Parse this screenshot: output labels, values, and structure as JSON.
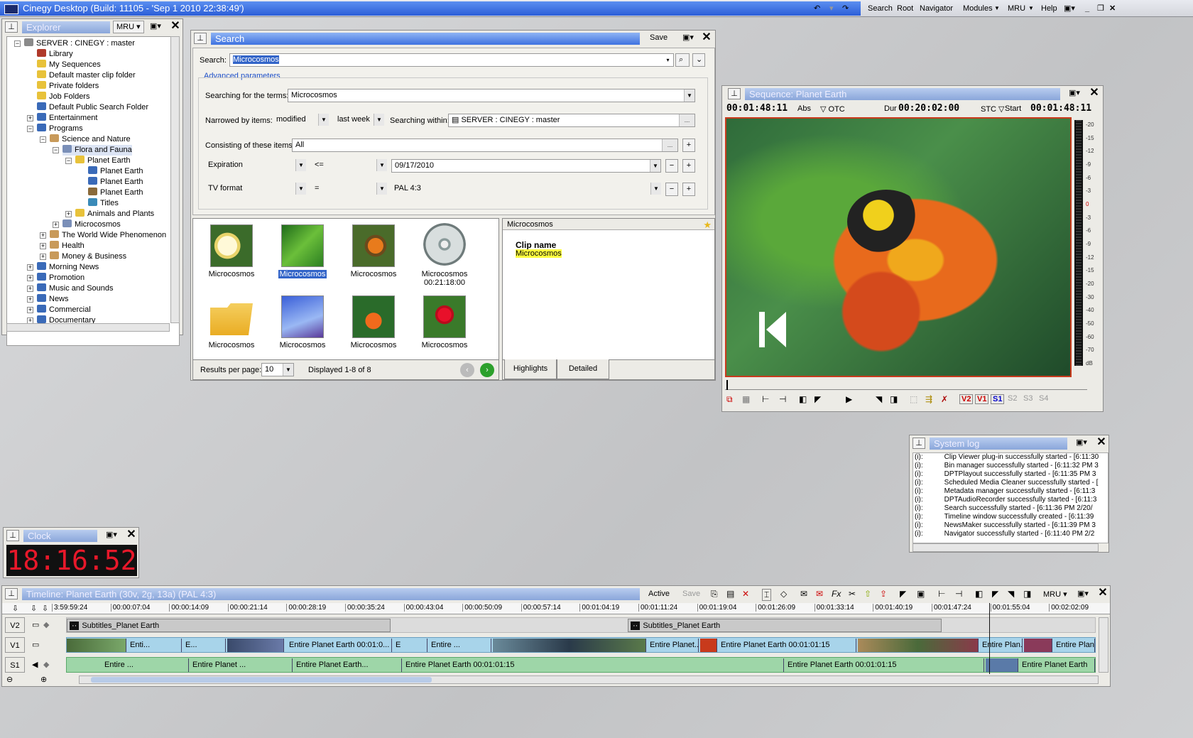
{
  "app": {
    "title": "Cinegy Desktop (Build: 11105 - 'Sep  1 2010 22:38:49')",
    "menu": [
      "Search",
      "Root",
      "Navigator",
      "Modules",
      "MRU",
      "Help"
    ]
  },
  "explorer": {
    "title": "Explorer",
    "mru": "MRU",
    "items": [
      {
        "label": "SERVER : CINEGY : master",
        "level": 0
      },
      {
        "label": "Library",
        "level": 1
      },
      {
        "label": "My Sequences",
        "level": 1
      },
      {
        "label": "Default master clip folder",
        "level": 1
      },
      {
        "label": "Private folders",
        "level": 1
      },
      {
        "label": "Job Folders",
        "level": 1
      },
      {
        "label": "Default Public Search Folder",
        "level": 1
      },
      {
        "label": "Entertainment",
        "level": 1
      },
      {
        "label": "Programs",
        "level": 1
      },
      {
        "label": "Science and Nature",
        "level": 2
      },
      {
        "label": "Flora and Fauna",
        "level": 3
      },
      {
        "label": "Planet Earth",
        "level": 4
      },
      {
        "label": "Planet Earth",
        "level": 5
      },
      {
        "label": "Planet Earth",
        "level": 5
      },
      {
        "label": "Planet Earth",
        "level": 5
      },
      {
        "label": "Titles",
        "level": 5
      },
      {
        "label": "Animals and Plants",
        "level": 4
      },
      {
        "label": "Microcosmos",
        "level": 3
      },
      {
        "label": "The World Wide Phenomenon",
        "level": 2
      },
      {
        "label": "Health",
        "level": 2
      },
      {
        "label": "Money & Business",
        "level": 2
      },
      {
        "label": "Morning News",
        "level": 1
      },
      {
        "label": "Promotion",
        "level": 1
      },
      {
        "label": "Music and Sounds",
        "level": 1
      },
      {
        "label": "News",
        "level": 1
      },
      {
        "label": "Commercial",
        "level": 1
      },
      {
        "label": "Documentary",
        "level": 1
      }
    ]
  },
  "search": {
    "title": "Search",
    "save": "Save",
    "search_label": "Search:",
    "search_value": "Microcosmos",
    "advanced": "Advanced parameters",
    "terms_label": "Searching for the terms:",
    "terms_value": "Microcosmos",
    "narrowed_label": "Narrowed by items:",
    "narrowed_value": "modified",
    "period_value": "last week",
    "within_label": "Searching within:",
    "within_value": "SERVER : CINEGY : master",
    "consisting_label": "Consisting of these items:",
    "consisting_value": "All",
    "cond1": {
      "field": "Expiration",
      "op": "<=",
      "value": "09/17/2010"
    },
    "cond2": {
      "field": "TV format",
      "op": "=",
      "value": "PAL 4:3"
    },
    "results": [
      {
        "label": "Microcosmos",
        "sub": ""
      },
      {
        "label": "Microcosmos",
        "sub": ""
      },
      {
        "label": "Microcosmos",
        "sub": ""
      },
      {
        "label": "Microcosmos",
        "sub": "00:21:18:00"
      },
      {
        "label": "Microcosmos",
        "sub": ""
      },
      {
        "label": "Microcosmos",
        "sub": ""
      },
      {
        "label": "Microcosmos",
        "sub": ""
      },
      {
        "label": "Microcosmos",
        "sub": ""
      }
    ],
    "per_page_label": "Results per page:",
    "per_page_value": "10",
    "displayed": "Displayed 1-8 of 8",
    "detail_title": "Microcosmos",
    "clip_name_label": "Clip name",
    "clip_name_value": "Microcosmos",
    "tab_highlights": "Highlights",
    "tab_detailed": "Detailed"
  },
  "sequence": {
    "title": "Sequence: Planet Earth",
    "tc_current": "00:01:48:11",
    "abs": "Abs",
    "otc": "OTC",
    "dur_label": "Dur",
    "dur_value": "00:20:02:00",
    "stc": "STC",
    "start_label": "Start",
    "start_value": "00:01:48:11",
    "meter_ticks": [
      "-20",
      "-15",
      "-12",
      "-9",
      "-6",
      "-3",
      "0",
      "-3",
      "-6",
      "-9",
      "-12",
      "-15",
      "-20",
      "-30",
      "-40",
      "-50",
      "-60",
      "-70",
      "dB"
    ],
    "tracks": [
      "V2",
      "V1",
      "S1",
      "S2",
      "S3",
      "S4"
    ]
  },
  "syslog": {
    "title": "System log",
    "lines": [
      "Clip Viewer plug-in successfully started - [6:11:30",
      "Bin manager successfully started - [6:11:32 PM 3",
      "DPTPlayout successfully started - [6:11:35 PM 3",
      "Scheduled Media Cleaner successfully started - [",
      "Metadata manager successfully started - [6:11:3",
      "DPTAudioRecorder successfully started - [6:11:3",
      "Search successfully started - [6:11:36 PM 2/20/",
      "Timeline window successfully created - [6:11:39",
      "NewsMaker successfully started - [6:11:39 PM 3",
      "Navigator successfully started - [6:11:40 PM 2/2"
    ],
    "prefix": "(i):"
  },
  "clock": {
    "title": "Clock",
    "time": "18:16:52"
  },
  "timeline": {
    "title": "Timeline: Planet Earth (30v, 2g, 13a) (PAL 4:3)",
    "active": "Active",
    "save": "Save",
    "mru": "MRU",
    "ruler": [
      "3:59:59:24",
      "00:00:07:04",
      "00:00:14:09",
      "00:00:21:14",
      "00:00:28:19",
      "00:00:35:24",
      "00:00:43:04",
      "00:00:50:09",
      "00:00:57:14",
      "00:01:04:19",
      "00:01:11:24",
      "00:01:19:04",
      "00:01:26:09",
      "00:01:33:14",
      "00:01:40:19",
      "00:01:47:24",
      "00:01:55:04",
      "00:02:02:09"
    ],
    "track_labels": [
      "V2",
      "V1",
      "S1"
    ],
    "v2_clips": [
      "Subtitles_Planet Earth",
      "Subtitles_Planet Earth"
    ],
    "v1_clips": [
      "Enti...",
      "E...",
      "Entire Planet Earth 00:01:0...",
      "E",
      "Entire ...",
      "Entire Planet...",
      "Entire Planet Earth 00:01:01:15",
      "Entire Plan...",
      "Entire Plane"
    ],
    "s1_clips": [
      "Entire ...",
      "Entire Planet ...",
      "Entire Planet Earth...",
      "Entire Planet Earth 00:01:01:15",
      "Entire Planet Earth 00:01:01:15",
      "Entire Planet Earth"
    ]
  }
}
